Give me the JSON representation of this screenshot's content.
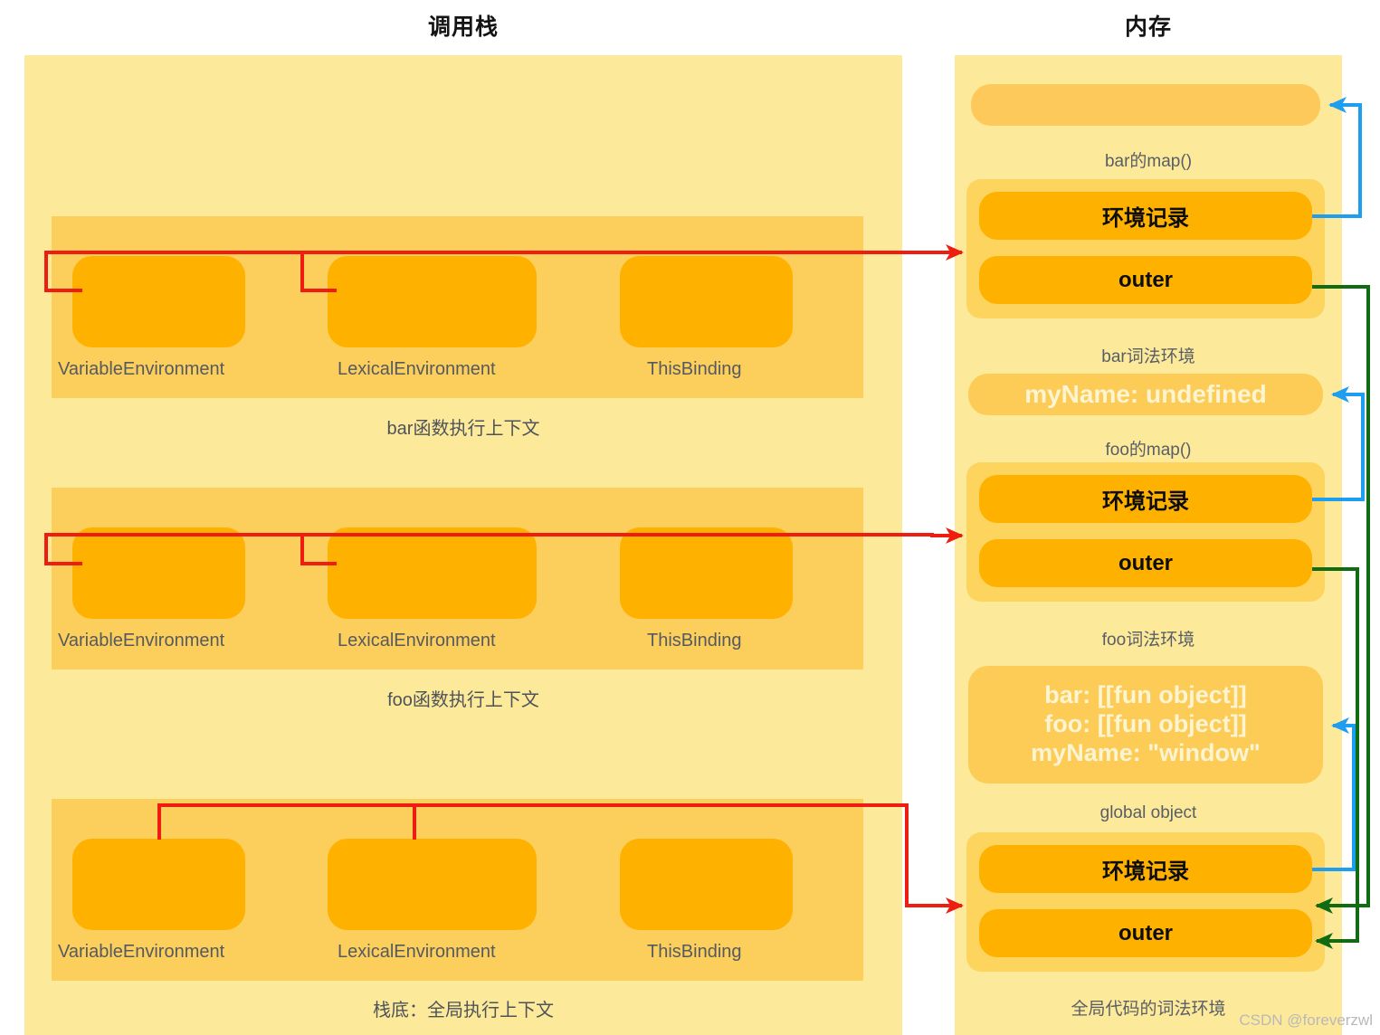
{
  "columns": {
    "call_stack_title": "调用栈",
    "memory_title": "内存"
  },
  "call_stack": {
    "slot_labels": [
      "VariableEnvironment",
      "LexicalEnvironment",
      "ThisBinding"
    ],
    "frames": [
      {
        "caption": "bar函数执行上下文"
      },
      {
        "caption": "foo函数执行上下文"
      },
      {
        "caption": "栈底：全局执行上下文"
      }
    ]
  },
  "memory": {
    "blocks": [
      {
        "kind": "empty-pill",
        "text": "",
        "caption": "bar的map()"
      },
      {
        "kind": "group",
        "rows": [
          "环境记录",
          "outer"
        ],
        "caption": "bar词法环境"
      },
      {
        "kind": "flat",
        "text": "myName: undefined",
        "caption": "foo的map()"
      },
      {
        "kind": "group",
        "rows": [
          "环境记录",
          "outer"
        ],
        "caption": "foo词法环境"
      },
      {
        "kind": "flat",
        "text": "bar: [[fun object]]\nfoo: [[fun object]]\nmyName: \"window\"",
        "caption": "global object"
      },
      {
        "kind": "group",
        "rows": [
          "环境记录",
          "outer"
        ],
        "caption": "全局代码的词法环境"
      }
    ]
  },
  "connectors": {
    "stack_to_memory_color": "#ee1c11",
    "env_record_color": "#1e9ef0",
    "outer_color": "#106b12"
  },
  "watermark": "CSDN @foreverzwl"
}
